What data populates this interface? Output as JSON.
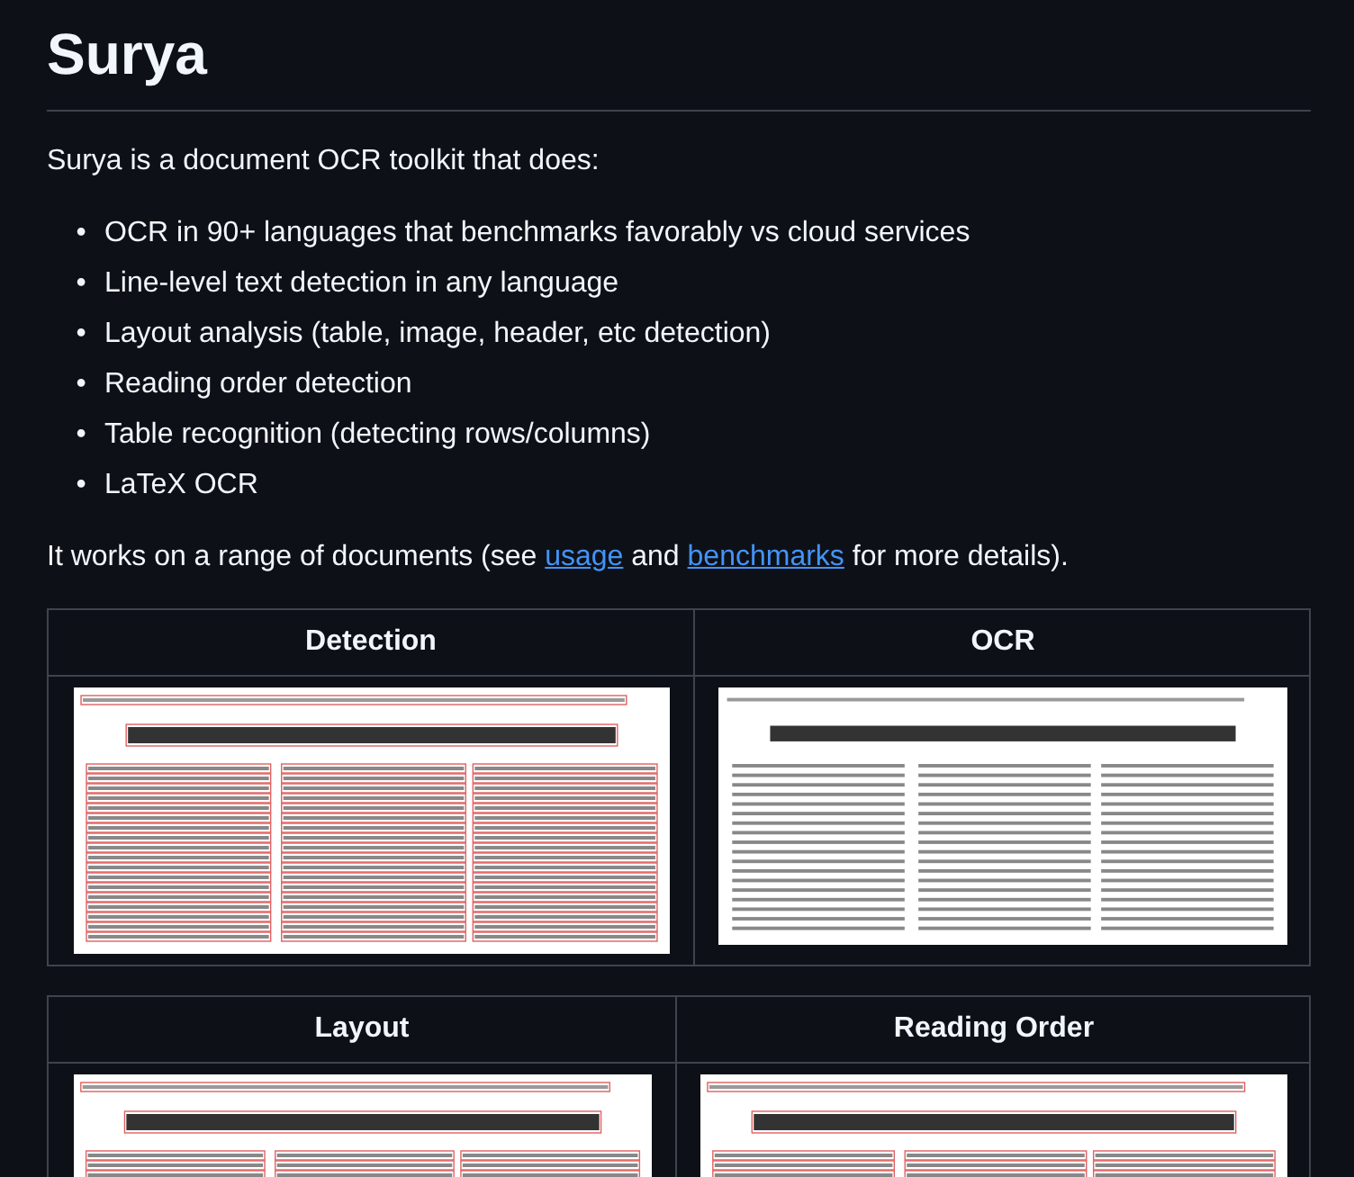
{
  "title": "Surya",
  "intro": "Surya is a document OCR toolkit that does:",
  "features": [
    {
      "marker": "•",
      "text": "OCR in 90+ languages that benchmarks favorably vs cloud services"
    },
    {
      "marker": "•",
      "text": "Line-level text detection in any language"
    },
    {
      "marker": "•",
      "text": "Layout analysis (table, image, header, etc detection)"
    },
    {
      "marker": "•",
      "text": "Reading order detection"
    },
    {
      "marker": "•",
      "text": "Table recognition (detecting rows/columns)"
    },
    {
      "marker": "•",
      "text": "LaTeX OCR"
    }
  ],
  "outro": [
    {
      "kind": "text",
      "text": "It works on a range of documents (see "
    },
    {
      "kind": "link",
      "text": "usage"
    },
    {
      "kind": "text",
      "text": " and "
    },
    {
      "kind": "link",
      "text": "benchmarks"
    },
    {
      "kind": "text",
      "text": " for more details)."
    }
  ],
  "tables": [
    {
      "columns": [
        {
          "heading": "Detection",
          "annotated": true
        },
        {
          "heading": "OCR",
          "annotated": false
        }
      ]
    },
    {
      "columns": [
        {
          "heading": "Layout",
          "annotated": true
        },
        {
          "heading": "Reading Order",
          "annotated": true
        }
      ]
    }
  ]
}
